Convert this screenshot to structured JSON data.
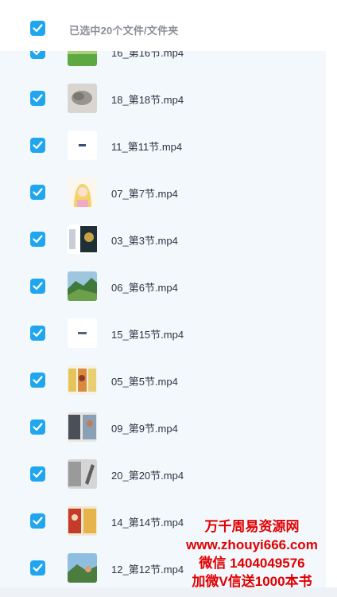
{
  "header": {
    "selection_text": "已选中20个文件/文件夹"
  },
  "rows": [
    {
      "name": "16_第16节.mp4",
      "thumb": "landscape-thumbnail"
    },
    {
      "name": "18_第18节.mp4",
      "thumb": "blurry-thumbnail"
    },
    {
      "name": "11_第11节.mp4",
      "thumb": "slide-thumbnail"
    },
    {
      "name": "07_第7节.mp4",
      "thumb": "cartoon-thumbnail"
    },
    {
      "name": "03_第3节.mp4",
      "thumb": "split-thumbnail"
    },
    {
      "name": "06_第6节.mp4",
      "thumb": "mountain-thumbnail"
    },
    {
      "name": "15_第15节.mp4",
      "thumb": "slide-thumbnail"
    },
    {
      "name": "05_第5节.mp4",
      "thumb": "cards-thumbnail"
    },
    {
      "name": "09_第9节.mp4",
      "thumb": "photo-thumbnail"
    },
    {
      "name": "20_第20节.mp4",
      "thumb": "sketch-thumbnail"
    },
    {
      "name": "14_第14节.mp4",
      "thumb": "comic-thumbnail"
    },
    {
      "name": "12_第12节.mp4",
      "thumb": "landscape-thumbnail"
    }
  ],
  "watermark": {
    "line1": "万千周易资源网",
    "line2": "www.zhouyi666.com",
    "line3": "微信 1404049576",
    "line4": "加微V信送1000本书"
  },
  "colors": {
    "checkbox": "#1fa6ef",
    "panel_bg": "#f3f8fd",
    "watermark": "#e00000"
  }
}
